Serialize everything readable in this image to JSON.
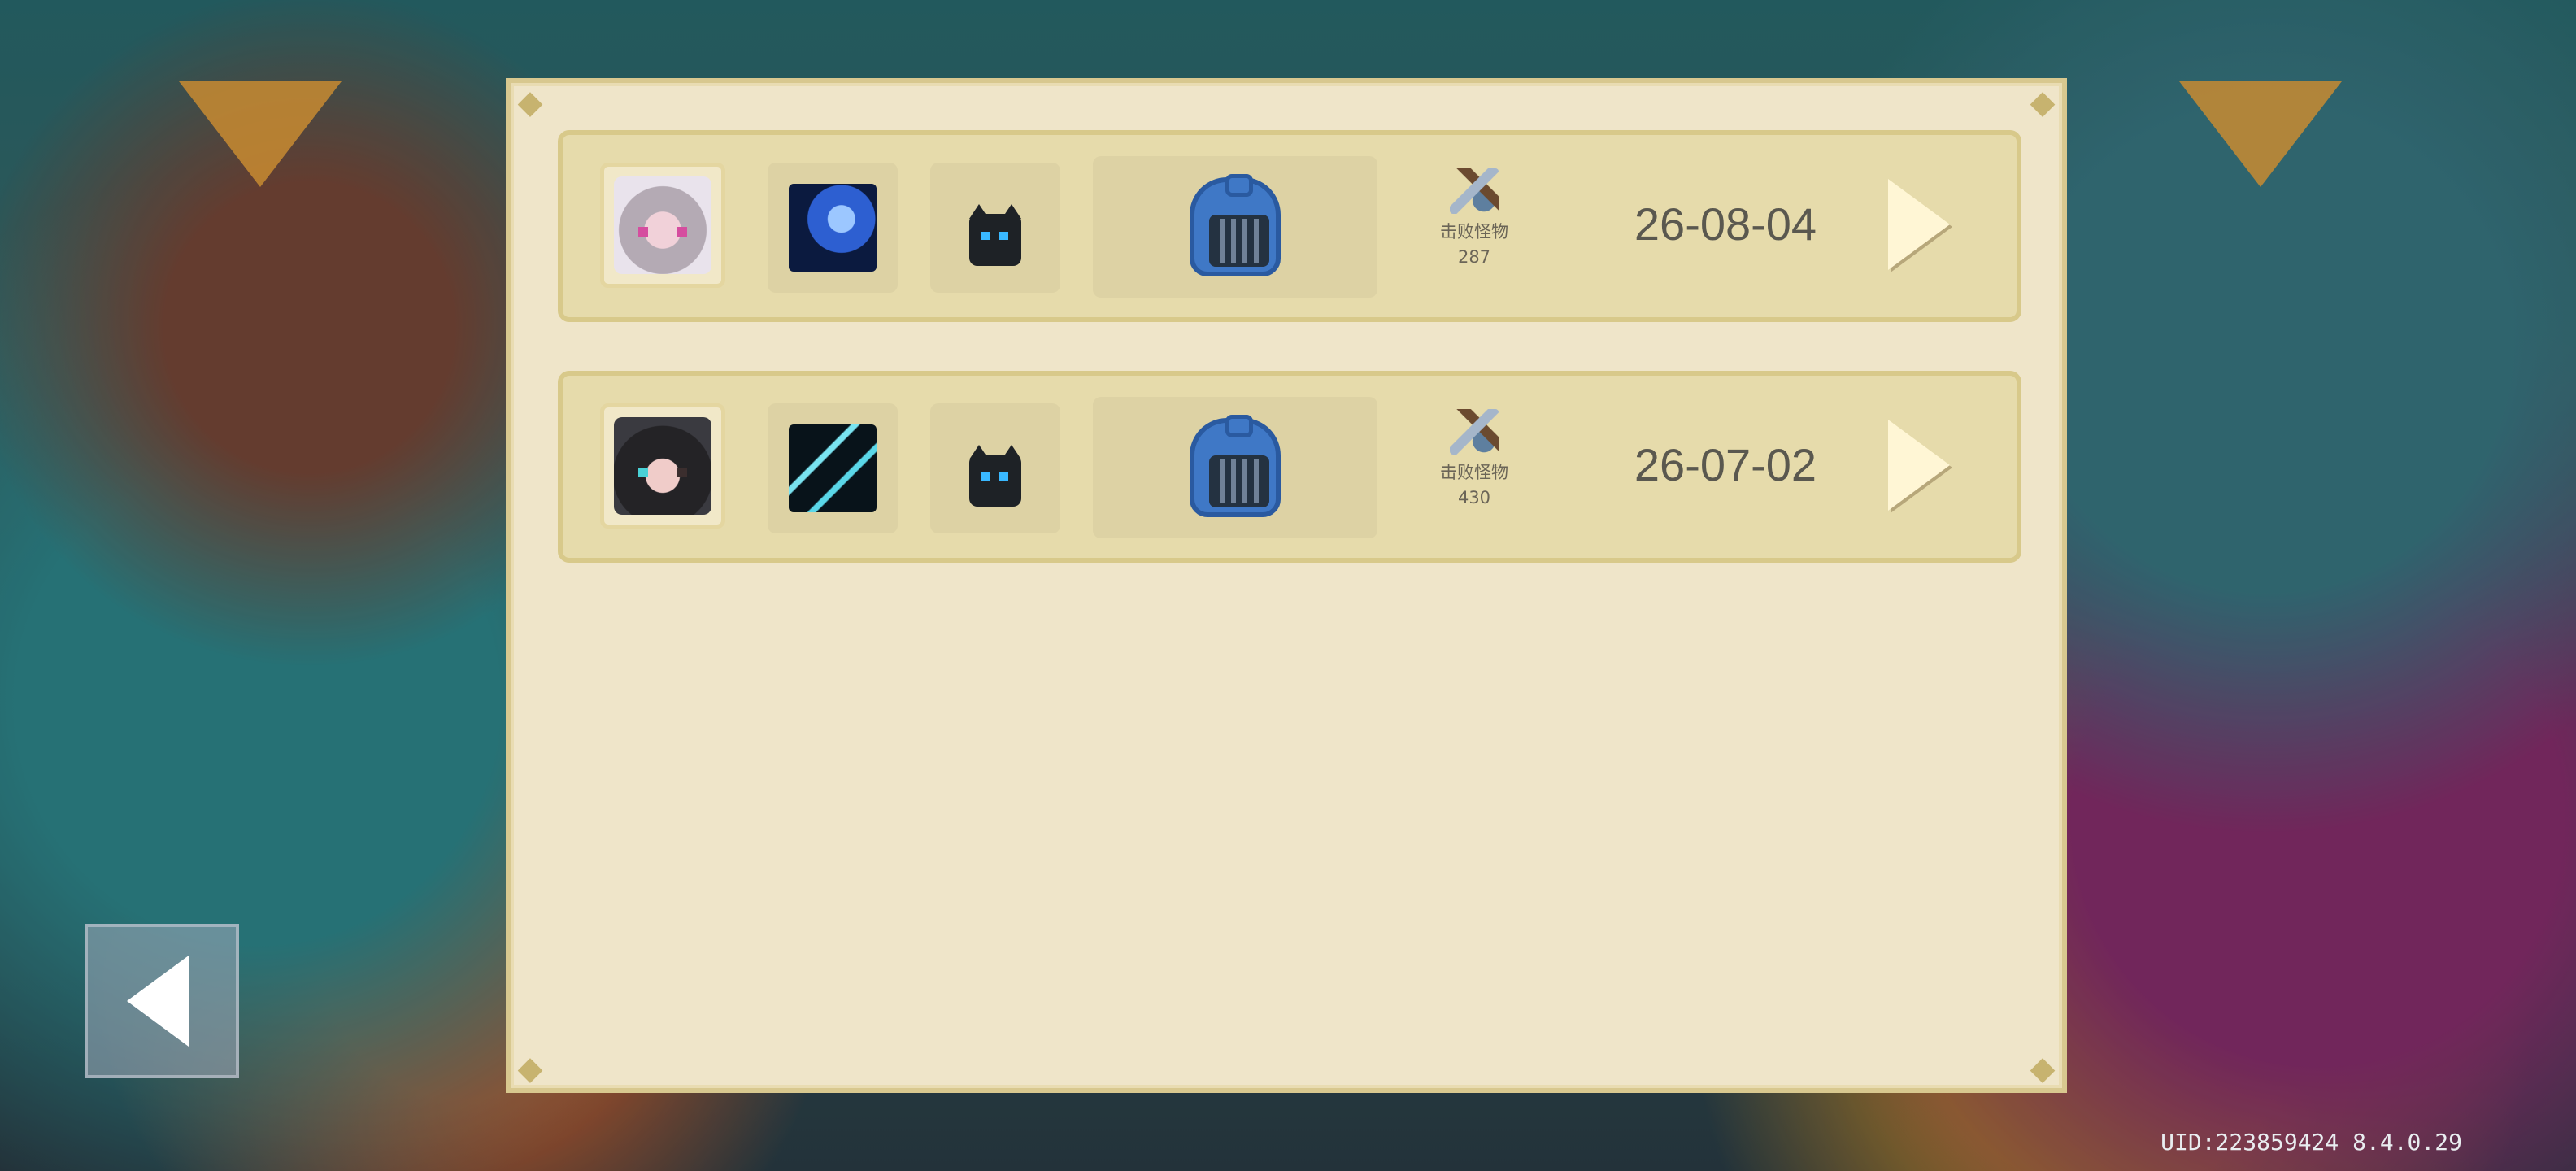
{
  "records": [
    {
      "character": "silver-haired-hero-portrait",
      "skill": "blue-wave-skill-icon",
      "pet": "black-cat-pet",
      "helmet": "blue-knight-helmet",
      "kills_label": "击败怪物",
      "kills_count": "287",
      "date": "26-08-04"
    },
    {
      "character": "dark-haired-hero-portrait",
      "skill": "ice-blade-skill-icon",
      "pet": "black-cat-pet",
      "helmet": "blue-knight-helmet",
      "kills_label": "击败怪物",
      "kills_count": "430",
      "date": "26-07-02"
    }
  ],
  "footer": {
    "uid_version": "UID:223859424 8.4.0.29"
  },
  "colors": {
    "panel_bg": "#efe5c9",
    "row_bg": "#e6dbab",
    "accent": "#d8c98a",
    "text": "#5a584f"
  },
  "icons": {
    "back": "back-arrow-icon",
    "detail": "chevron-right-icon",
    "kills": "sword-shield-icon"
  }
}
